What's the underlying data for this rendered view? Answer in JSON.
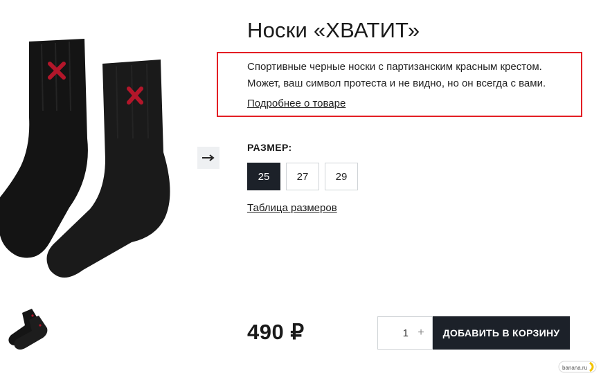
{
  "product": {
    "title": "Носки «ХВАТИТ»",
    "description_line1": "Спортивные черные носки с партизанским красным крестом.",
    "description_line2": "Может, ваш символ протеста и не видно, но он всегда с вами.",
    "more_link": "Подробнее о товаре"
  },
  "sizes": {
    "label": "РАЗМЕР:",
    "options": [
      "25",
      "27",
      "29"
    ],
    "selected": "25",
    "table_link": "Таблица размеров"
  },
  "purchase": {
    "price": "490 ₽",
    "quantity": "1",
    "plus": "+",
    "add_to_cart": "ДОБАВИТЬ В КОРЗИНУ"
  },
  "icons": {
    "next": "arrow-right-icon",
    "watermark_text": "banana.ru"
  },
  "colors": {
    "highlight_border": "#e31e24",
    "dark": "#1c2129",
    "sock_cross": "#b3162a"
  }
}
